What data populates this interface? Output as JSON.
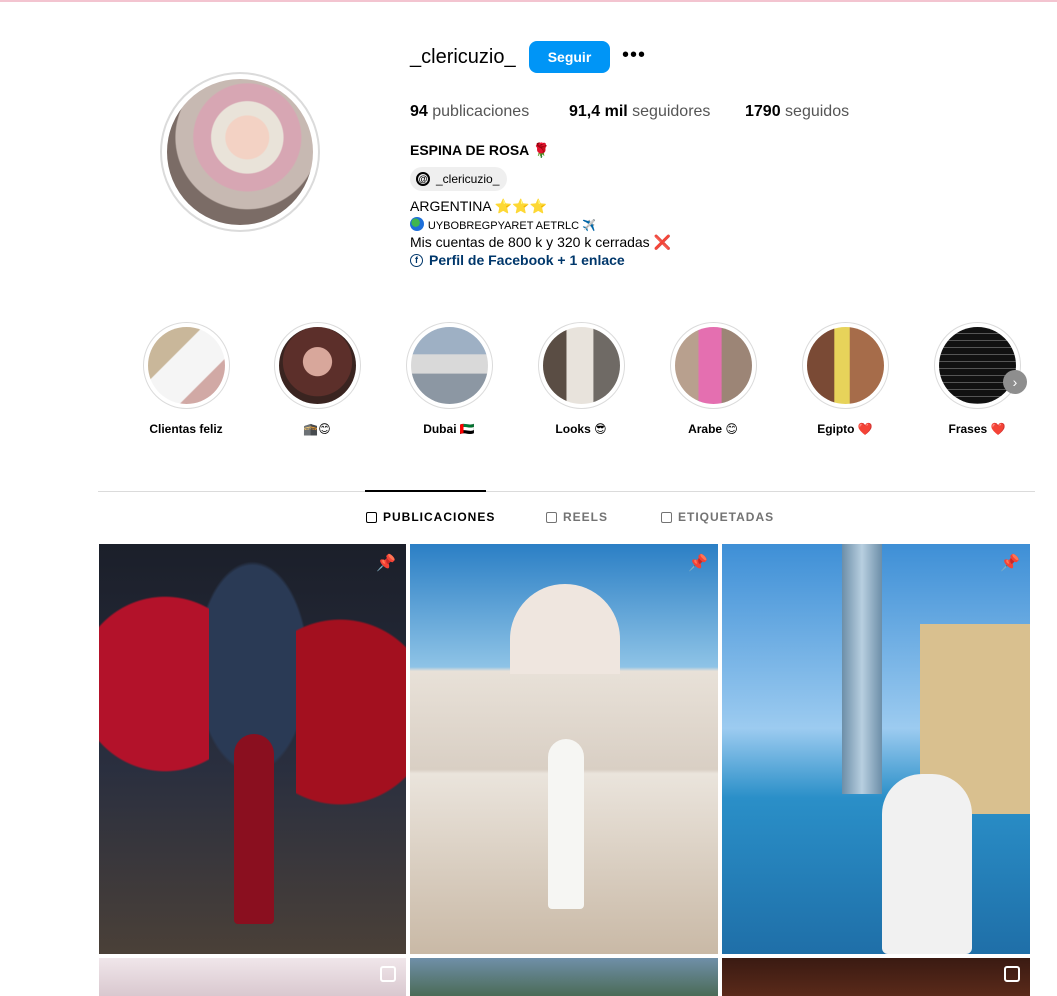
{
  "profile": {
    "username": "_clericuzio_",
    "follow_label": "Seguir",
    "more_label": "•••",
    "stats": {
      "posts_count": "94",
      "posts_label": "publicaciones",
      "followers_count": "91,4 mil",
      "followers_label": "seguidores",
      "following_count": "1790",
      "following_label": "seguidos"
    },
    "full_name": "ESPINA DE ROSA 🌹",
    "threads_handle": "_clericuzio_",
    "bio": {
      "line1": "ARGENTINA ⭐⭐⭐",
      "line2": "UYBOBREGPYARET AETRLC ✈️",
      "line3": "Mis cuentas de 800 k y 320 k cerradas ❌"
    },
    "link_text": "Perfil de Facebook + 1 enlace"
  },
  "highlights": [
    {
      "label": "Clientas feliz"
    },
    {
      "label": "🕋😊"
    },
    {
      "label": "Dubai 🇦🇪"
    },
    {
      "label": "Looks 😎"
    },
    {
      "label": "Arabe 😊"
    },
    {
      "label": "Egipto ❤️"
    },
    {
      "label": "Frases ❤️"
    }
  ],
  "tabs": [
    {
      "label": "PUBLICACIONES",
      "active": true
    },
    {
      "label": "REELS",
      "active": false
    },
    {
      "label": "ETIQUETADAS",
      "active": false
    }
  ],
  "icons": {
    "pin": "pushpin-icon",
    "multi": "carousel-icon",
    "next": "chevron-right-icon",
    "threads": "threads-icon",
    "facebook": "facebook-icon",
    "grid": "grid-icon",
    "reels": "reels-icon",
    "tagged": "tagged-icon"
  },
  "colors": {
    "accent": "#0095f6",
    "link": "#00376b"
  }
}
